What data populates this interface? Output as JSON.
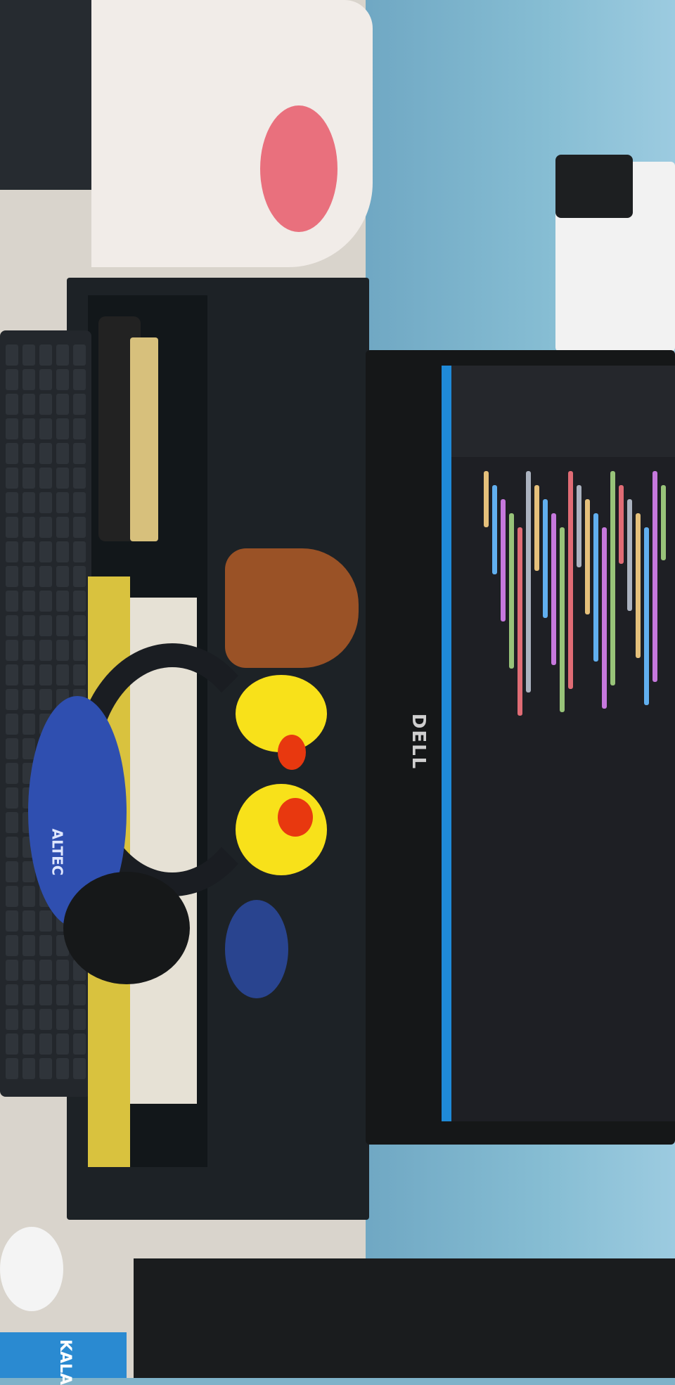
{
  "scene": {
    "monitor_brand": "DELL",
    "headphone_brand": "ALTEC",
    "box_label": "KALA",
    "editor_accent": "#1f8ad8",
    "duck_color": "#f8e11a",
    "cup_color": "#9a5226"
  }
}
